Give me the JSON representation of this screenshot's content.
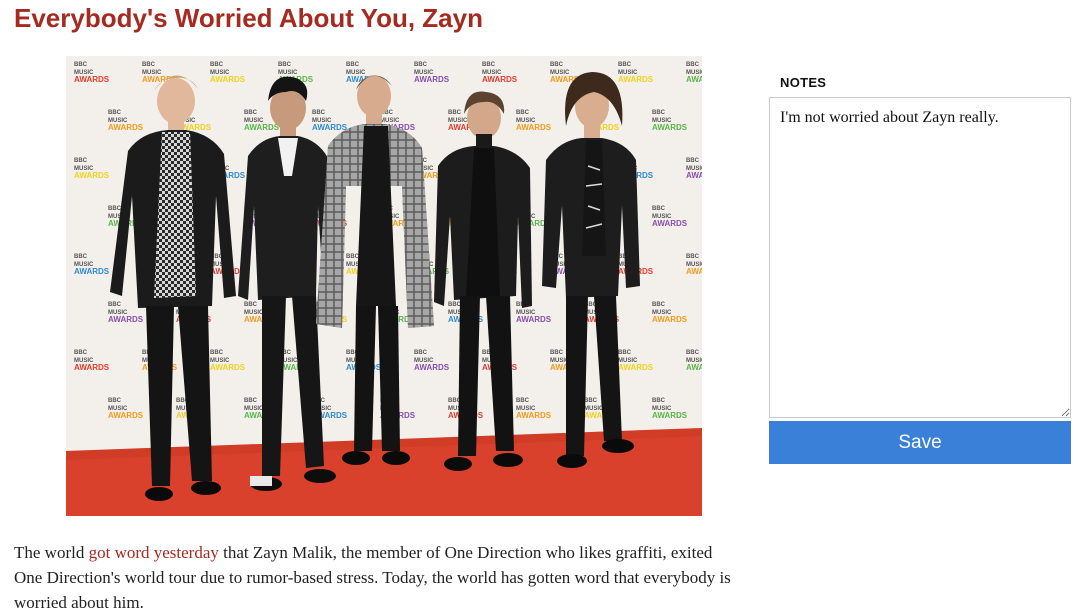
{
  "article": {
    "title": "Everybody's Worried About You, Zayn",
    "photo_alt": "One Direction band members on red carpet",
    "backdrop_logo": [
      "BBC",
      "MUSIC",
      "AWARDS"
    ],
    "body_before_link": "The world ",
    "body_link": "got word yesterday",
    "body_after_link": " that Zayn Malik, the member of One Direction who likes graffiti, exited One Direction's world tour due to rumor-based stress. Today, the world has gotten word that everybody is worried about him."
  },
  "notes": {
    "label": "NOTES",
    "value": "I'm not worried about Zayn really.",
    "save_label": "Save"
  },
  "colors": {
    "headline": "#a52a1f",
    "link": "#a52a1f",
    "save_button": "#3a80d9",
    "carpet": "#d9412c"
  }
}
